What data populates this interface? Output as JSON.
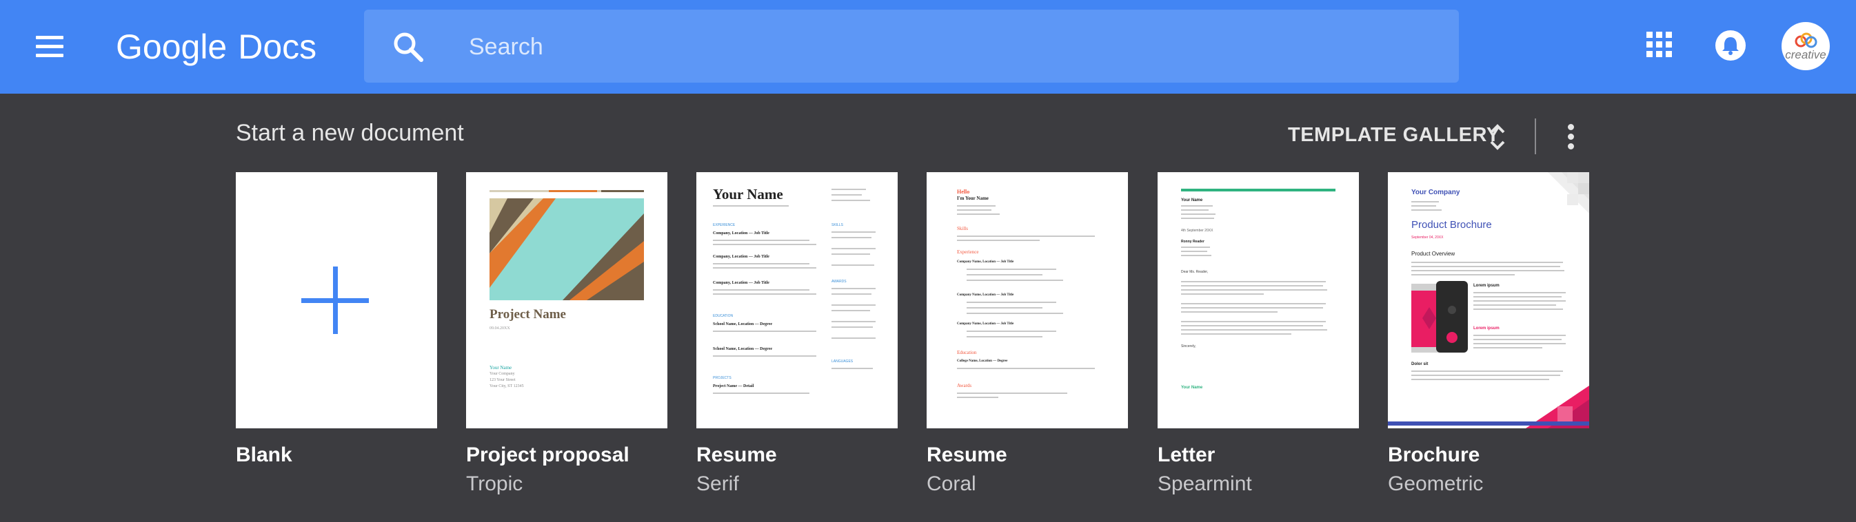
{
  "header": {
    "menu_icon": "hamburger-menu-icon",
    "logo": {
      "google": "Google",
      "product": "Docs"
    },
    "search": {
      "placeholder": "Search",
      "value": ""
    },
    "apps_icon": "apps-grid-icon",
    "notifications_icon": "bell-icon",
    "avatar_text": "creative",
    "colors": {
      "bar": "#4285f4",
      "search_bg": "#5d97f6"
    }
  },
  "main": {
    "section_title": "Start a new document",
    "template_gallery_label": "TEMPLATE GALLERY",
    "background": "#3c3c40",
    "templates": [
      {
        "title": "Blank",
        "subtitle": ""
      },
      {
        "title": "Project proposal",
        "subtitle": "Tropic",
        "thumb": {
          "heading": "Project Name",
          "date": "09.04.20XX",
          "contact_name": "Your Name",
          "contact_lines": [
            "Your Company",
            "123 Your Street",
            "Your City, ST 12345"
          ]
        }
      },
      {
        "title": "Resume",
        "subtitle": "Serif",
        "thumb": {
          "heading": "Your Name",
          "section_1": "EXPERIENCE",
          "section_2": "EDUCATION",
          "section_3": "PROJECTS",
          "side_1": "SKILLS",
          "side_2": "AWARDS",
          "side_3": "LANGUAGES",
          "entry_1": "Company, Location — Job Title",
          "entry_2": "School Name, Location — Degree",
          "entry_3": "Project Name — Detail"
        }
      },
      {
        "title": "Resume",
        "subtitle": "Coral",
        "thumb": {
          "greeting": "Hello",
          "heading": "I'm Your Name",
          "section_1": "Skills",
          "section_2": "Experience",
          "section_3": "Education",
          "section_4": "Awards",
          "entry_1": "Company Name, Location — Job Title",
          "entry_2": "College Name, Location — Degree"
        }
      },
      {
        "title": "Letter",
        "subtitle": "Spearmint",
        "thumb": {
          "sender": "Your Name",
          "date": "4th September 20XX",
          "recipient": "Ronny Reader",
          "salutation": "Dear Ms. Reader,",
          "closing": "Sincerely,",
          "signature": "Your Name"
        }
      },
      {
        "title": "Brochure",
        "subtitle": "Geometric",
        "thumb": {
          "company": "Your Company",
          "heading": "Product Brochure",
          "date": "September 04, 20XX",
          "section_1": "Product Overview",
          "section_2": "Lorem ipsum",
          "section_3": "Dolor sit"
        }
      }
    ]
  }
}
